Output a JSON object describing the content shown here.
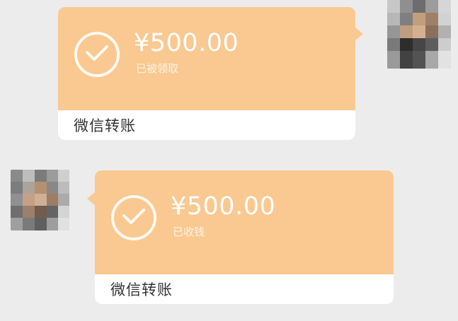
{
  "conversation": {
    "messages": [
      {
        "direction": "outgoing",
        "amount": "¥500.00",
        "status": "已被领取",
        "footer_label": "微信转账"
      },
      {
        "direction": "incoming",
        "amount": "¥500.00",
        "status": "已收钱",
        "footer_label": "微信转账"
      }
    ]
  },
  "icons": {
    "transfer_status": "check-circle-icon"
  },
  "colors": {
    "background": "#ececec",
    "bubble": "#f9c991",
    "footer": "#ffffff",
    "footer_text": "#333333"
  }
}
